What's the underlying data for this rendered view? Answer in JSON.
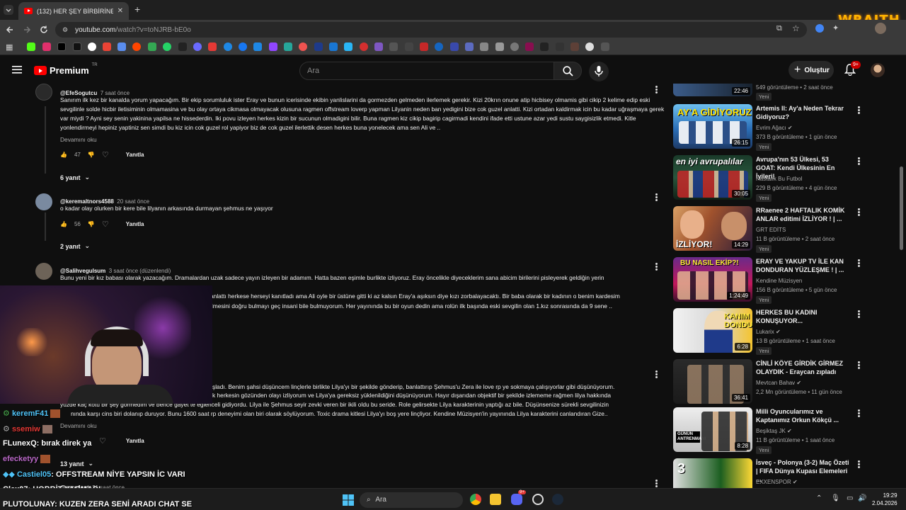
{
  "browser": {
    "tab_title": "(132) HER ŞEY BİRBİRİNE GİRDİ",
    "url_main": "youtube.com",
    "url_path": "/watch?v=toNJRB-bE0o",
    "wraith_label": "WRAITH"
  },
  "header": {
    "logo_text": "Premium",
    "logo_sup": "TR",
    "search_placeholder": "Ara",
    "create_label": "Oluştur",
    "notif_count": "9+"
  },
  "comments": [
    {
      "handle": "@EfeSogutcu",
      "time": "7 saat önce",
      "text": "Sanırım ilk kez bir kanalda yorum yapacağım. Bir ekip sorumluluk ister Eray ve bunun icerisinde ekibin yanlislarini da gormezden gelmeden ilerlemek gerekir. Kizi 20krın onune atip hicbisey olmamis gibi cikip 2 kelime edip eski sevgilinle solde hicbir iletisiminin olmamasina ve bu olay ortaya cikmasa olmayacak olusuna ragmen offstream loverp yapman Lilyanin neden ban yedigini bize cok guzel anlatti. Kizi ortadan kaldirmak icin bu kadar uğraşmaya gerek var miydi ? Ayni sey senin yakinina yapilsa ne hissederdin. Iki povu izleyen herkes kizin bir sucunun olmadigini bilir. Buna ragmen kiz cikip bagirip cagirmadi kendini ifade etti ustune azar yedi sustu saygisizlik etmedi. Kitle yonlendirmeyi hepiniz yaptiniz sen simdi bu kiz icin cok guzel rol yapiyor biz de cok guzel ilerlettik desen herkes buna yonelecek ama sen Ali ve ..",
      "more": "Devamını oku",
      "likes": "47",
      "reply": "Yanıtla",
      "replies": "6 yanıt"
    },
    {
      "handle": "@keremaltnors4588",
      "time": "20 saat önce",
      "text": "o kadar olay olurken bir kere bile lilyanın arkasında durmayan şehmus ne yaşıyor",
      "likes": "56",
      "reply": "Yanıtla",
      "replies": "2 yanıt"
    },
    {
      "handle": "@Salihvegulsum",
      "time": "3 saat önce (düzenlendi)",
      "text_line1": "Bunu yeni bir kız babası olarak yazacağım. Dramalardan uzak sadece yayın izleyen bir adamım. Hatta bazen eşimle burlikte izliyoruz. Eray öncelikle diyeceklerim sana abicim birilerini pisleyerek geldiğin yerin",
      "text_line2": "anlattı herkese herseyi kanıtladı ama Ali oyle bir üstüne gitti ki az kalsın Eray'a aşıksın diye kızı zorbalayacaktı. Bir baba olarak bir kadının o benim kardesim",
      "text_line3": "ilmesini doğru bulmayı geç insani bile bulmuyorum. Her yayınında bu bir oyun dedin ama rolün ilk başında eski sevgilin olan 1.kız sonrasında da 9 sene .."
    },
    {
      "text_line1": "şladı. Benim şahsi düşüncem linçlerle birlikte Lilya'yı bir şekilde gönderip, banlattırıp Şehmus'u Zera ile love rp ye sokmaya çalışıyorlar gibi düşünüyorum.",
      "text_line2": "k herkesin gözünden olayı izliyorum ve Lilya'ya gereksiz yüklenildiğini düşünüyorum. Hayır dışarıdan objektif bir şekilde izlememe rağmen lilya hakkında",
      "text_line3": "yüzde kaç kötü bir şey görmedim ve bence gayet te eğlenceli gidiyordu. Lilya ile Şehmus seyir zevki veren bir ikili oldu bu seride. Role gelirsekte Lilya karakterinin yaptığı az bile. Düşünsenize sürekli sevgilinizin",
      "text_line4": "nında karşı cins biri dolanıp duruyor. Bunu 1600 saat rp deneyimi olan biri olarak söylüyorum. Toxic drama kitlesi Lilya'yı boş yere linçliyor. Kendine Müzisyen'in yayınında Lilya karakterini canlandıran Gize..",
      "more": "Devamını oku",
      "reply": "Yanıtla",
      "replies": "13 yanıt"
    },
    {
      "handle": "@serc4snt",
      "time": "21 saat önce"
    }
  ],
  "sidebar": [
    {
      "title": "",
      "channel": "",
      "meta": "549 görüntüleme • 2 saat önce",
      "badge": "Yeni",
      "duration": "22:46"
    },
    {
      "title": "Artemis II: Ay'a Neden Tekrar Gidiyoruz?",
      "channel": "Evrim Ağacı",
      "meta": "373 B görüntüleme • 1 gün önce",
      "badge": "Yeni",
      "duration": "26:15",
      "thumb_text": "AY'A GİDİYORUZ!"
    },
    {
      "title": "Avrupa'nın 53 Ülkesi, 53 GOAT: Kendi Ülkesinin En İyileri!",
      "channel": "Hastalık Bu Futbol",
      "meta": "229 B görüntüleme • 4 gün önce",
      "badge": "Yeni",
      "duration": "30:05",
      "thumb_text": "en iyi avrupalılar"
    },
    {
      "title": "RRaenee 2 HAFTALIK KOMİK ANLAR editimi İZLİYOR ! | ...",
      "channel": "GRT EDİTS",
      "meta": "11 B görüntüleme • 2 saat önce",
      "badge": "Yeni",
      "duration": "14:29",
      "thumb_text": "İZLİYOR!"
    },
    {
      "title": "ERAY VE YAKUP TV İLE KAN DONDURAN YÜZLEŞME ! | ...",
      "channel": "Kendine Müzisyen",
      "meta": "156 B görüntüleme • 5 gün önce",
      "badge": "Yeni",
      "duration": "1:24:49",
      "thumb_text": "BU NASIL EKİP?!"
    },
    {
      "title": "HERKES BU KADINI KONUŞUYOR...",
      "channel": "Lukarix",
      "meta": "13 B görüntüleme • 1 saat önce",
      "badge": "Yeni",
      "duration": "6:28",
      "thumb_text": "KANIM DONDU"
    },
    {
      "title": "CİNLİ KÖYE GİRDİK GİRMEZ OLAYDIK - Eraycan zıpladı",
      "channel": "Mevtcan Bahav",
      "meta": "2,2 Mn görüntüleme • 11 gün önce",
      "badge": "",
      "duration": "36:41",
      "thumb_text": ""
    },
    {
      "title": "Milli Oyuncularımız ve Kaptanımız Orkun Kökçü ...",
      "channel": "Beşiktaş JK",
      "meta": "11 B görüntüleme • 1 saat önce",
      "badge": "Yeni",
      "duration": "8:28",
      "thumb_text": "GÜNÜN ANTRENMANI"
    },
    {
      "title": "İsveç - Polonya (3-2) Maç Özeti | FIFA Dünya Kupası Elemeleri ...",
      "channel": "EXXENSPOR",
      "meta": "",
      "badge": "",
      "duration": "",
      "thumb_text": ""
    }
  ],
  "chat": [
    {
      "user": "keremF41",
      "msg": "",
      "color": "#4fc3f7"
    },
    {
      "user": "ssemiw",
      "msg": "",
      "color": "#e53935"
    },
    {
      "user": "FLunexQ",
      "msg": ": bırak direk ya",
      "color": "#ffffff"
    },
    {
      "user": "efecketyy",
      "msg": "",
      "color": "#ba68c8"
    },
    {
      "user": "Castiel05",
      "msg": ": OFFSTREAM NİYE YAPSIN İC VARI",
      "color": "#4fc3f7"
    },
    {
      "user": "Clex07",
      "msg": ": HOBBİT YAOMADI",
      "color": "#ffffff"
    },
    {
      "user": "PLUTOLUNAY",
      "msg": ": KUZEN ZERA SENİ ARADI CHAT SE",
      "color": "#ffffff"
    }
  ],
  "taskbar": {
    "search": "Ara",
    "time": "19:29",
    "date": "2.04.2026",
    "discord_badge": "9+"
  }
}
